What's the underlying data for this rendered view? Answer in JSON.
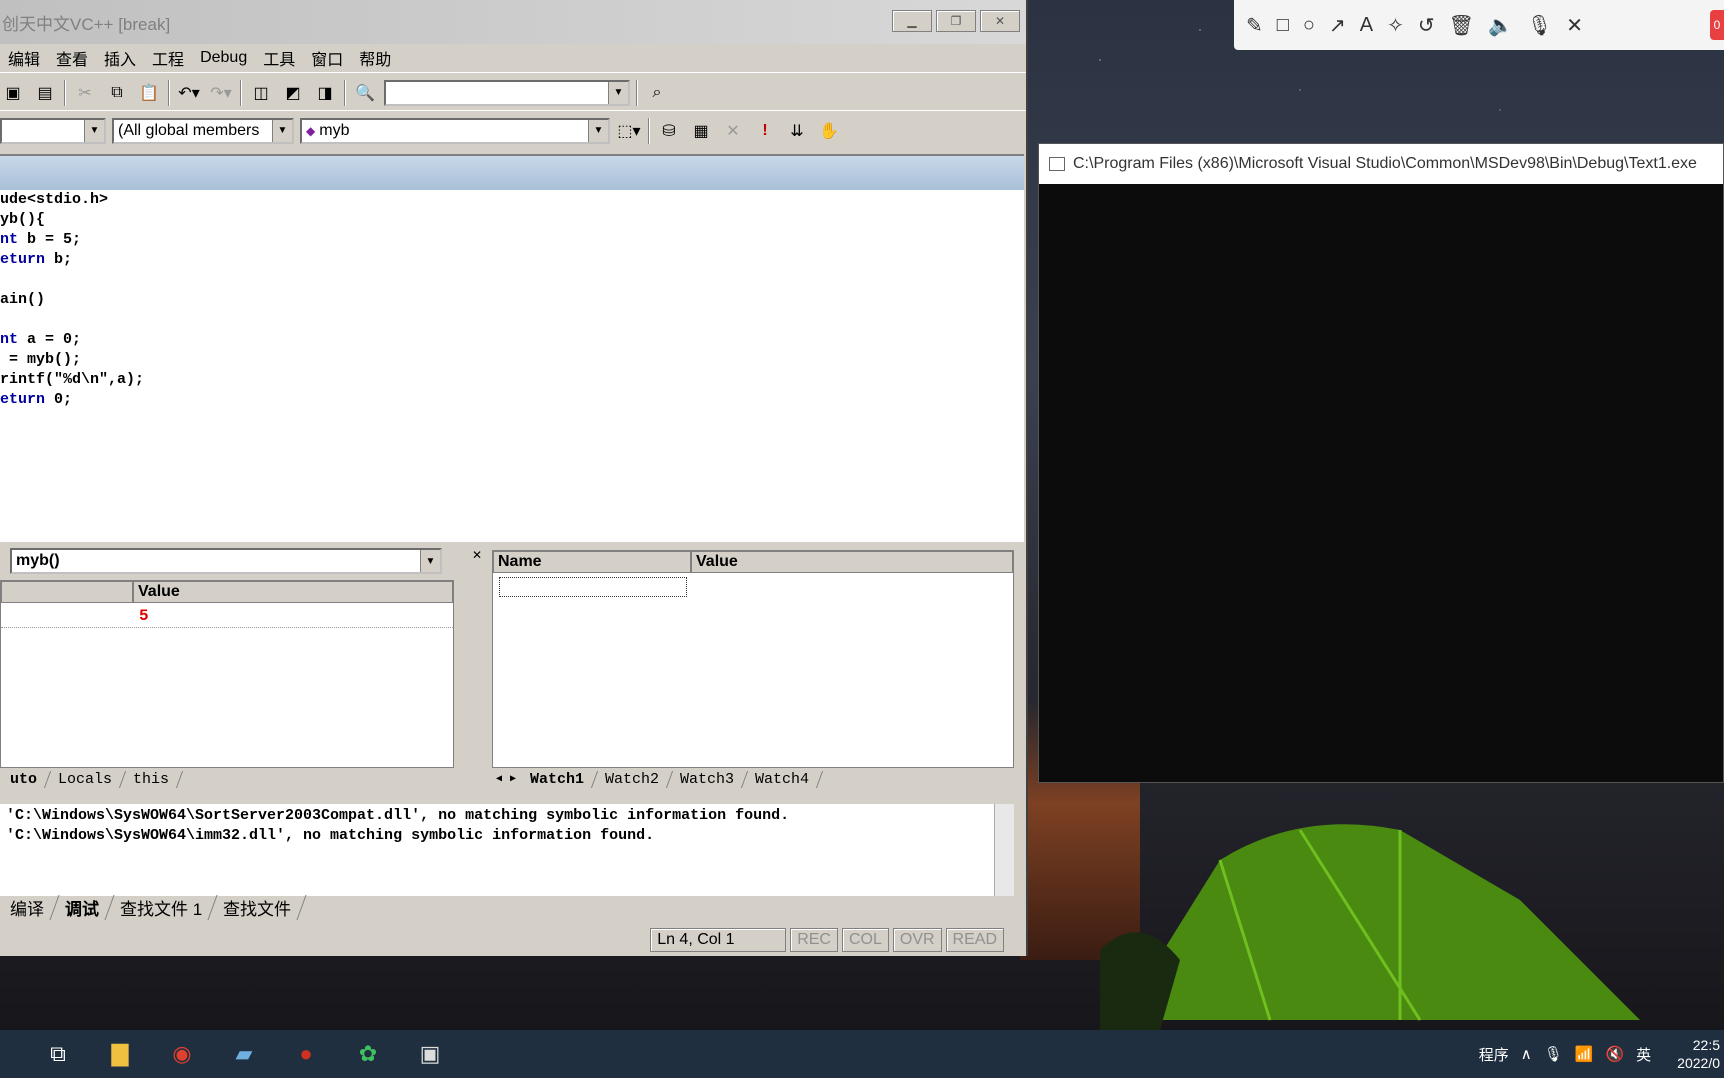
{
  "window": {
    "title": "创天中文VC++ [break]"
  },
  "menu": [
    "编辑",
    "查看",
    "插入",
    "工程",
    "Debug",
    "工具",
    "窗口",
    "帮助"
  ],
  "wizardbar": {
    "scope": "(All global members",
    "function": "myb"
  },
  "code": {
    "lines": [
      {
        "kw": "",
        "text": "ude<stdio.h>"
      },
      {
        "kw": "",
        "text": "yb(){"
      },
      {
        "kw": "nt",
        "text": " b = 5;"
      },
      {
        "kw": "eturn",
        "text": " b;"
      },
      {
        "kw": "",
        "text": ""
      },
      {
        "kw": "",
        "text": "ain()"
      },
      {
        "kw": "",
        "text": ""
      },
      {
        "kw": "nt",
        "text": " a = 0;"
      },
      {
        "kw": "",
        "text": " = myb();"
      },
      {
        "kw": "",
        "text": "rintf(\"%d\\n\",a);"
      },
      {
        "kw": "eturn",
        "text": " 0;"
      }
    ]
  },
  "variables": {
    "context": "myb()",
    "value_header": "Value",
    "rows": [
      {
        "value": "5"
      }
    ],
    "tabs": [
      "uto",
      "Locals",
      "this"
    ]
  },
  "watch": {
    "name_header": "Name",
    "value_header": "Value",
    "tabs": [
      "Watch1",
      "Watch2",
      "Watch3",
      "Watch4"
    ]
  },
  "output": {
    "lines": [
      "'C:\\Windows\\SysWOW64\\SortServer2003Compat.dll', no matching symbolic information found.",
      "'C:\\Windows\\SysWOW64\\imm32.dll', no matching symbolic information found."
    ],
    "tabs": [
      "编译",
      "调试",
      "查找文件 1",
      "查找文件"
    ]
  },
  "status": {
    "position": "Ln 4, Col 1",
    "indicators": [
      "REC",
      "COL",
      "OVR",
      "READ"
    ]
  },
  "console": {
    "title": "C:\\Program Files (x86)\\Microsoft Visual Studio\\Common\\MSDev98\\Bin\\Debug\\Text1.exe"
  },
  "taskbar": {
    "tray_label": "程序",
    "ime": "英",
    "time": "22:5",
    "date": "2022/0"
  }
}
